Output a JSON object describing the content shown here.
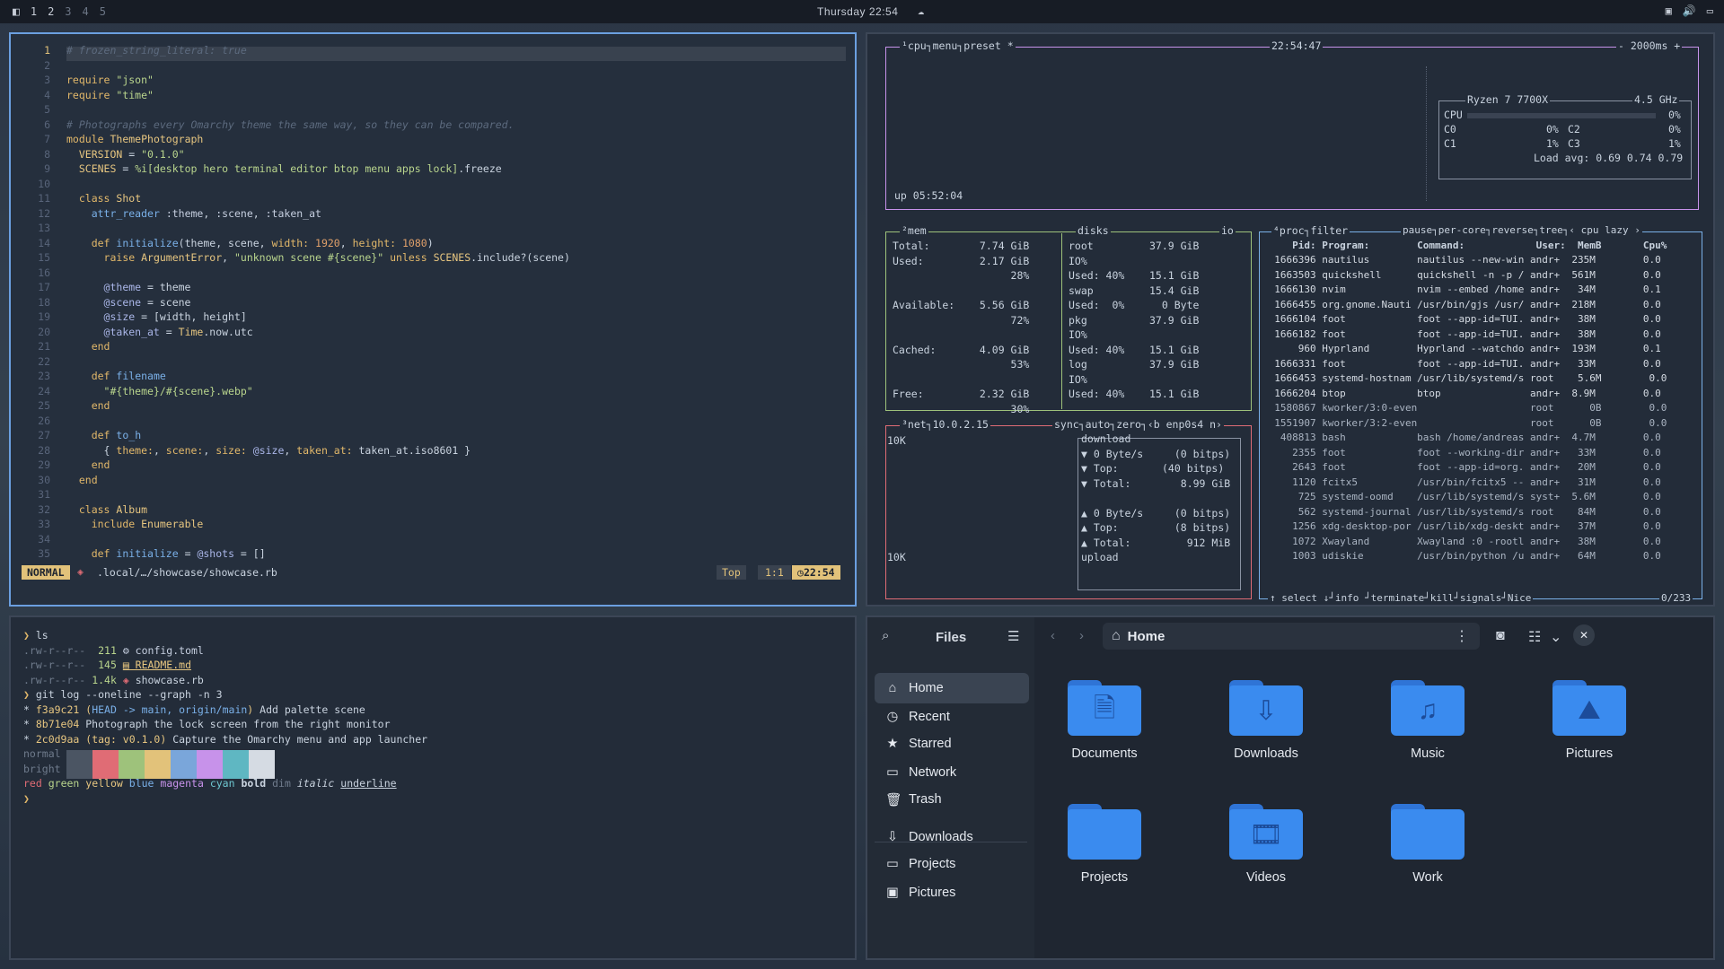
{
  "topbar": {
    "workspaces": [
      "1",
      "2",
      "3",
      "4",
      "5"
    ],
    "clock": "Thursday 22:54"
  },
  "editor": {
    "lines": [
      {
        "n": "1",
        "html": "<span class='cm'># frozen_string_literal: true</span>"
      },
      {
        "n": "2",
        "html": ""
      },
      {
        "n": "3",
        "html": "<span class='kw'>require</span> <span class='st'>\"json\"</span>"
      },
      {
        "n": "4",
        "html": "<span class='kw'>require</span> <span class='st'>\"time\"</span>"
      },
      {
        "n": "5",
        "html": ""
      },
      {
        "n": "6",
        "html": "<span class='cm'># Photographs every Omarchy theme the same way, so they can be compared.</span>"
      },
      {
        "n": "7",
        "html": "<span class='kw'>module</span> <span class='cls'>ThemePhotograph</span>"
      },
      {
        "n": "8",
        "html": "  <span class='cst'>VERSION</span> = <span class='st'>\"0.1.0\"</span>"
      },
      {
        "n": "9",
        "html": "  <span class='cst'>SCENES</span> = <span class='st'>%i[desktop hero terminal editor btop menu apps lock]</span>.freeze"
      },
      {
        "n": "10",
        "html": ""
      },
      {
        "n": "11",
        "html": "  <span class='kw'>class</span> <span class='cls'>Shot</span>"
      },
      {
        "n": "12",
        "html": "    <span class='fn'>attr_reader</span> <span class='sym'>:theme</span>, <span class='sym'>:scene</span>, <span class='sym'>:taken_at</span>"
      },
      {
        "n": "13",
        "html": ""
      },
      {
        "n": "14",
        "html": "    <span class='kw'>def</span> <span class='fn'>initialize</span>(theme, scene, <span class='kw'>width:</span> <span class='num'>1920</span>, <span class='kw'>height:</span> <span class='num'>1080</span>)"
      },
      {
        "n": "15",
        "html": "      <span class='kw'>raise</span> <span class='cls'>ArgumentError</span>, <span class='st'>\"unknown scene #{scene}\"</span> <span class='kw'>unless</span> <span class='cst'>SCENES</span>.include?(scene)"
      },
      {
        "n": "16",
        "html": ""
      },
      {
        "n": "17",
        "html": "      <span class='iv'>@theme</span> = theme"
      },
      {
        "n": "18",
        "html": "      <span class='iv'>@scene</span> = scene"
      },
      {
        "n": "19",
        "html": "      <span class='iv'>@size</span> = [width, height]"
      },
      {
        "n": "20",
        "html": "      <span class='iv'>@taken_at</span> = <span class='cls'>Time</span>.now.utc"
      },
      {
        "n": "21",
        "html": "    <span class='kw'>end</span>"
      },
      {
        "n": "22",
        "html": ""
      },
      {
        "n": "23",
        "html": "    <span class='kw'>def</span> <span class='fn'>filename</span>"
      },
      {
        "n": "24",
        "html": "      <span class='st'>\"#{theme}/#{scene}.webp\"</span>"
      },
      {
        "n": "25",
        "html": "    <span class='kw'>end</span>"
      },
      {
        "n": "26",
        "html": ""
      },
      {
        "n": "27",
        "html": "    <span class='kw'>def</span> <span class='fn'>to_h</span>"
      },
      {
        "n": "28",
        "html": "      { <span class='kw'>theme:</span>, <span class='kw'>scene:</span>, <span class='kw'>size:</span> <span class='iv'>@size</span>, <span class='kw'>taken_at:</span> taken_at.iso8601 }"
      },
      {
        "n": "29",
        "html": "    <span class='kw'>end</span>"
      },
      {
        "n": "30",
        "html": "  <span class='kw'>end</span>"
      },
      {
        "n": "31",
        "html": ""
      },
      {
        "n": "32",
        "html": "  <span class='kw'>class</span> <span class='cls'>Album</span>"
      },
      {
        "n": "33",
        "html": "    <span class='kw'>include</span> <span class='cls'>Enumerable</span>"
      },
      {
        "n": "34",
        "html": ""
      },
      {
        "n": "35",
        "html": "    <span class='kw'>def</span> <span class='fn'>initialize</span> = <span class='iv'>@shots</span> = []"
      }
    ],
    "status": {
      "mode": "NORMAL",
      "path": ".local/…/showcase/showcase.rb",
      "pos": "Top",
      "linecol": "1:1",
      "time": "22:54"
    }
  },
  "terminal": {
    "lines": [
      {
        "html": "<span style='color:#e2b86a'>❯</span> ls"
      },
      {
        "html": "<span style='color:#6f7b8c'>.rw-r--r--</span>  <span style='color:#b9d58d'>211</span> <span style='color:#c6cfe0'>⚙ config.toml</span>"
      },
      {
        "html": "<span style='color:#6f7b8c'>.rw-r--r--</span>  <span style='color:#b9d58d'>145</span> <span style='color:#e7c680;text-decoration:underline'>▤ README.md</span>"
      },
      {
        "html": "<span style='color:#6f7b8c'>.rw-r--r--</span> <span style='color:#b9d58d'>1.4k</span> <span style='color:#e06c75'>◈</span> showcase.rb"
      },
      {
        "html": "<span style='color:#e2b86a'>❯</span> git log --oneline --graph -n 3"
      },
      {
        "html": "* <span style='color:#e7c680'>f3a9c21</span> <span style='color:#e7c680'>(</span><span style='color:#7ab0e8'>HEAD -&gt; main, origin/main</span><span style='color:#e7c680'>)</span> Add palette scene"
      },
      {
        "html": "* <span style='color:#e7c680'>8b71e04</span> Photograph the lock screen from the right monitor"
      },
      {
        "html": "* <span style='color:#e7c680'>2c0d9aa</span> <span style='color:#e7c680'>(tag: v0.1.0)</span> Capture the Omarchy menu and app launcher"
      },
      {
        "html": "<span style='color:#6f7b8c'>normal</span>"
      },
      {
        "html": "<span style='color:#6f7b8c'>bright</span>"
      },
      {
        "html": "<span style='color:#e06c75'>red</span> <span style='color:#b9d58d'>green</span> <span style='color:#e7c680'>yellow</span> <span style='color:#7ab0e8'>blue</span> <span style='color:#c792ea'>magenta</span> <span style='color:#6fc8d2'>cyan</span> <b>bold</b> <span style='color:#6f7b8c'>dim</span> <i>italic</i> <u>underline</u>"
      },
      {
        "html": "<span style='color:#e2b86a'>❯</span>"
      }
    ],
    "palette_normal": [
      "#4b5563",
      "#e06c75",
      "#9ec27b",
      "#e2c27a",
      "#7aa6da",
      "#c792ea",
      "#5fb7c2",
      "#d5dbe3"
    ],
    "palette_bright": [
      "#4b5563",
      "#e06c75",
      "#9ec27b",
      "#e2c27a",
      "#7aa6da",
      "#c792ea",
      "#5fb7c2",
      "#d5dbe3"
    ]
  },
  "btop": {
    "cpu_box": {
      "head": "¹cpu┐menu┐preset *",
      "clock": "22:54:47",
      "rate": "- 2000ms +",
      "uptime": "up 05:52:04",
      "model": "Ryzen 7 7700X",
      "freq": "4.5 GHz",
      "cpu_total": "CPU",
      "cpu_pct": "0%",
      "cores": [
        {
          "l": "C0",
          "v": "0%",
          "l2": "C2",
          "v2": "0%"
        },
        {
          "l": "C1",
          "v": "1%",
          "l2": "C3",
          "v2": "1%"
        }
      ],
      "load": "Load avg: 0.69 0.74 0.79"
    },
    "mem": {
      "head": "²mem",
      "lines": [
        "Total:        7.74 GiB",
        "Used:         2.17 GiB",
        "                   28%",
        "",
        "Available:    5.56 GiB",
        "                   72%",
        "",
        "Cached:       4.09 GiB",
        "                   53%",
        "",
        "Free:         2.32 GiB",
        "                   30%"
      ]
    },
    "disks": {
      "head": "disks",
      "io": "io",
      "lines": [
        "root         37.9 GiB",
        "IO%",
        "Used: 40%    15.1 GiB",
        "swap         15.4 GiB",
        "Used:  0%      0 Byte",
        "pkg          37.9 GiB",
        "IO%",
        "Used: 40%    15.1 GiB",
        "log          37.9 GiB",
        "IO%",
        "Used: 40%    15.1 GiB"
      ]
    },
    "net": {
      "head": "³net┐10.0.2.15",
      "opts": "sync┐auto┐zero┐‹b enp0s4 n›",
      "scale_top": "10K",
      "scale_bot": "10K",
      "lines": [
        "download",
        "▼ 0 Byte/s     (0 bitps)",
        "▼ Top:       (40 bitps)",
        "▼ Total:        8.99 GiB",
        "",
        "▲ 0 Byte/s     (0 bitps)",
        "▲ Top:         (8 bitps)",
        "▲ Total:         912 MiB",
        "upload"
      ]
    },
    "proc": {
      "head": "⁴proc┐filter",
      "opts": "pause┐per-core┐reverse┐tree┐‹ cpu lazy ›",
      "columns": "     Pid: Program:        Command:            User:  MemB       Cpu%",
      "rows": [
        "  1666396 nautilus        nautilus --new-win andr+  235M        0.0",
        "  1663503 quickshell      quickshell -n -p / andr+  561M        0.0",
        "  1666130 nvim            nvim --embed /home andr+   34M        0.1",
        "  1666455 org.gnome.Nauti /usr/bin/gjs /usr/ andr+  218M        0.0",
        "  1666104 foot            foot --app-id=TUI. andr+   38M        0.0",
        "  1666182 foot            foot --app-id=TUI. andr+   38M        0.0",
        "      960 Hyprland        Hyprland --watchdo andr+  193M        0.1",
        "  1666331 foot            foot --app-id=TUI. andr+   33M        0.0",
        "  1666453 systemd-hostnam /usr/lib/systemd/s root    5.6M        0.0",
        "  1666204 btop            btop               andr+  8.9M        0.0",
        "  1580867 kworker/3:0-even                   root      0B        0.0",
        "  1551907 kworker/3:2-even                   root      0B        0.0",
        "   408813 bash            bash /home/andreas andr+  4.7M        0.0",
        "     2355 foot            foot --working-dir andr+   33M        0.0",
        "     2643 foot            foot --app-id=org. andr+   20M        0.0",
        "     1120 fcitx5          /usr/bin/fcitx5 -- andr+   31M        0.0",
        "      725 systemd-oomd    /usr/lib/systemd/s syst+  5.6M        0.0",
        "      562 systemd-journal /usr/lib/systemd/s root    84M        0.0",
        "     1256 xdg-desktop-por /usr/lib/xdg-deskt andr+   37M        0.0",
        "     1072 Xwayland        Xwayland :0 -rootl andr+   38M        0.0",
        "     1003 udiskie         /usr/bin/python /u andr+   64M        0.0"
      ],
      "footer": "↑ select ↓┘info ┘terminate┘kill┘signals┘Nice",
      "count": "0/233"
    }
  },
  "files": {
    "title": "Files",
    "location": "Home",
    "sidebar": [
      {
        "label": "Home",
        "icon": "home-icon",
        "glyph": "⌂"
      },
      {
        "label": "Recent",
        "icon": "clock-icon",
        "glyph": "◷"
      },
      {
        "label": "Starred",
        "icon": "star-icon",
        "glyph": "★"
      },
      {
        "label": "Network",
        "icon": "network-icon",
        "glyph": "▭"
      },
      {
        "label": "Trash",
        "icon": "trash-icon",
        "glyph": "🗑"
      },
      {
        "label": "Downloads",
        "icon": "download-icon",
        "glyph": "⇩"
      },
      {
        "label": "Projects",
        "icon": "folder-icon",
        "glyph": "▭"
      },
      {
        "label": "Pictures",
        "icon": "image-icon",
        "glyph": "▣"
      }
    ],
    "folders": [
      {
        "label": "Documents",
        "glyph": "🗎"
      },
      {
        "label": "Downloads",
        "glyph": "⇩"
      },
      {
        "label": "Music",
        "glyph": "♫"
      },
      {
        "label": "Pictures",
        "glyph": "⛰"
      },
      {
        "label": "Projects",
        "glyph": ""
      },
      {
        "label": "Videos",
        "glyph": "🎞"
      },
      {
        "label": "Work",
        "glyph": ""
      }
    ]
  }
}
